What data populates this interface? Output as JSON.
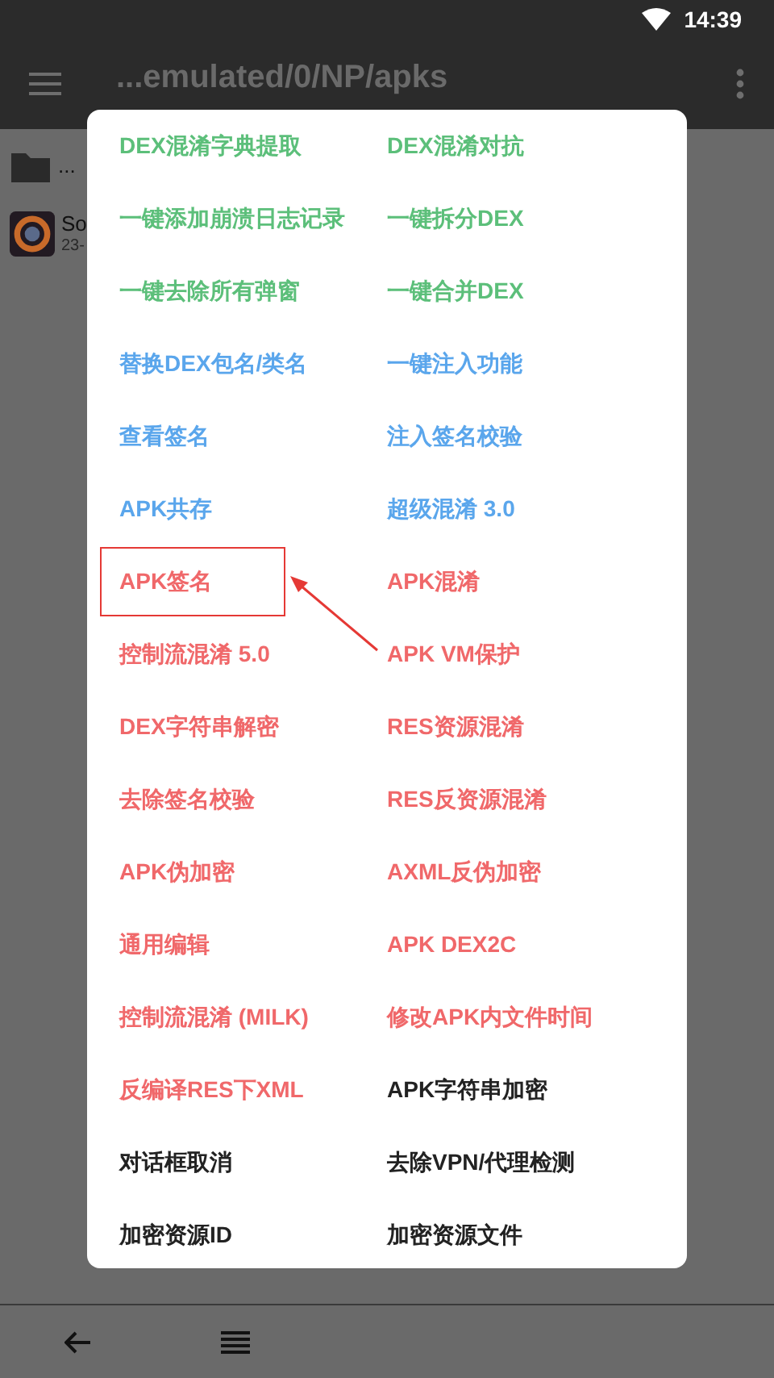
{
  "status_bar": {
    "time": "14:39"
  },
  "app_bar": {
    "title": "...emulated/0/NP/apks"
  },
  "files": [
    {
      "kind": "folder",
      "name": "..."
    },
    {
      "kind": "app",
      "name": "So",
      "date": "23-"
    }
  ],
  "menu": [
    {
      "label": "DEX混淆字典提取",
      "color": "#5cbf7a",
      "highlighted": false
    },
    {
      "label": "DEX混淆对抗",
      "color": "#5cbf7a",
      "highlighted": false
    },
    {
      "label": "一键添加崩溃日志记录",
      "color": "#5cbf7a",
      "highlighted": false
    },
    {
      "label": "一键拆分DEX",
      "color": "#5cbf7a",
      "highlighted": false
    },
    {
      "label": "一键去除所有弹窗",
      "color": "#5cbf7a",
      "highlighted": false
    },
    {
      "label": "一键合并DEX",
      "color": "#5cbf7a",
      "highlighted": false
    },
    {
      "label": "替换DEX包名/类名",
      "color": "#5aa6ec",
      "highlighted": false
    },
    {
      "label": "一键注入功能",
      "color": "#5aa6ec",
      "highlighted": false
    },
    {
      "label": "查看签名",
      "color": "#5aa6ec",
      "highlighted": false
    },
    {
      "label": "注入签名校验",
      "color": "#5aa6ec",
      "highlighted": false
    },
    {
      "label": "APK共存",
      "color": "#5aa6ec",
      "highlighted": false
    },
    {
      "label": "超级混淆 3.0",
      "color": "#5aa6ec",
      "highlighted": false
    },
    {
      "label": "APK签名",
      "color": "#f0686a",
      "highlighted": true
    },
    {
      "label": "APK混淆",
      "color": "#f0686a",
      "highlighted": false
    },
    {
      "label": "控制流混淆 5.0",
      "color": "#f0686a",
      "highlighted": false
    },
    {
      "label": "APK VM保护",
      "color": "#f0686a",
      "highlighted": false
    },
    {
      "label": "DEX字符串解密",
      "color": "#f0686a",
      "highlighted": false
    },
    {
      "label": "RES资源混淆",
      "color": "#f0686a",
      "highlighted": false
    },
    {
      "label": "去除签名校验",
      "color": "#f0686a",
      "highlighted": false
    },
    {
      "label": "RES反资源混淆",
      "color": "#f0686a",
      "highlighted": false
    },
    {
      "label": "APK伪加密",
      "color": "#f0686a",
      "highlighted": false
    },
    {
      "label": "AXML反伪加密",
      "color": "#f0686a",
      "highlighted": false
    },
    {
      "label": "通用编辑",
      "color": "#f0686a",
      "highlighted": false
    },
    {
      "label": "APK DEX2C",
      "color": "#f0686a",
      "highlighted": false
    },
    {
      "label": "控制流混淆 (MILK)",
      "color": "#f0686a",
      "highlighted": false
    },
    {
      "label": "修改APK内文件时间",
      "color": "#f0686a",
      "highlighted": false
    },
    {
      "label": "反编译RES下XML",
      "color": "#f0686a",
      "highlighted": false
    },
    {
      "label": "APK字符串加密",
      "color": "#222222",
      "highlighted": false
    },
    {
      "label": "对话框取消",
      "color": "#222222",
      "highlighted": false
    },
    {
      "label": "去除VPN/代理检测",
      "color": "#222222",
      "highlighted": false
    },
    {
      "label": "加密资源ID",
      "color": "#222222",
      "highlighted": false
    },
    {
      "label": "加密资源文件",
      "color": "#222222",
      "highlighted": false
    }
  ]
}
